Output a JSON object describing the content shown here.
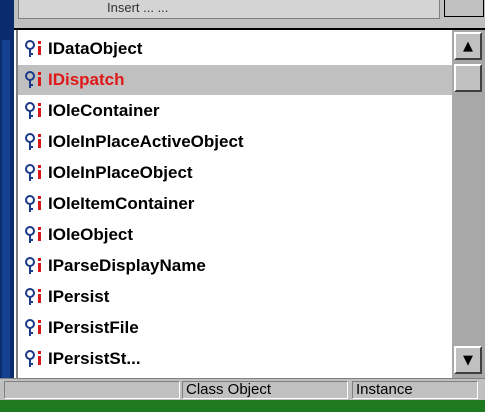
{
  "top_field": {
    "text": "Insert ... ..."
  },
  "list": {
    "icon": "interface-icon",
    "items": [
      {
        "label": "IDataObject",
        "selected": false
      },
      {
        "label": "IDispatch",
        "selected": true
      },
      {
        "label": "IOleContainer",
        "selected": false
      },
      {
        "label": "IOleInPlaceActiveObject",
        "selected": false
      },
      {
        "label": "IOleInPlaceObject",
        "selected": false
      },
      {
        "label": "IOleItemContainer",
        "selected": false
      },
      {
        "label": "IOleObject",
        "selected": false
      },
      {
        "label": "IParseDisplayName",
        "selected": false
      },
      {
        "label": "IPersist",
        "selected": false
      },
      {
        "label": "IPersistFile",
        "selected": false
      },
      {
        "label": "IPersistSt...",
        "selected": false
      }
    ]
  },
  "scrollbar": {
    "up_icon": "scroll-up-arrow",
    "down_icon": "scroll-down-arrow"
  },
  "status": {
    "class_object": "Class Object",
    "instance": "Instance"
  },
  "colors": {
    "selected_text": "#e01818",
    "icon_key": "#1c3a8a",
    "icon_i": "#d81818"
  }
}
